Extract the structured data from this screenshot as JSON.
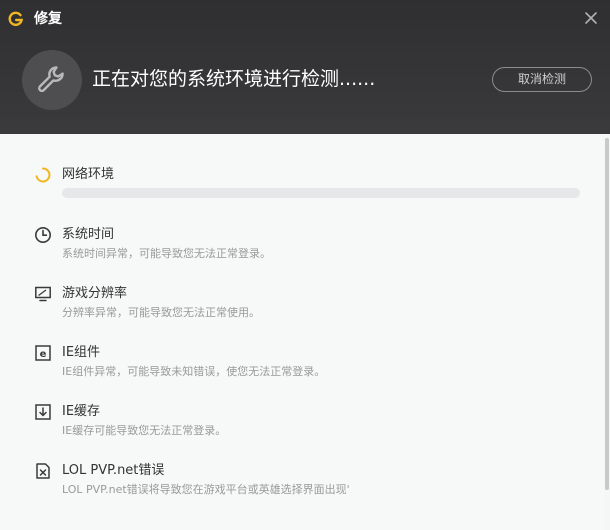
{
  "window": {
    "title": "修复",
    "close_icon": "close-icon",
    "logo_icon": "g-logo-icon"
  },
  "header": {
    "headline": "正在对您的系统环境进行检测......",
    "cancel_label": "取消检测",
    "icon": "wrench-icon"
  },
  "items": [
    {
      "icon": "loading-spinner-icon",
      "title": "网络环境",
      "progress": 0,
      "status": "checking"
    },
    {
      "icon": "clock-icon",
      "title": "系统时间",
      "description": "系统时间异常，可能导致您无法正常登录。"
    },
    {
      "icon": "monitor-icon",
      "title": "游戏分辨率",
      "description": "分辨率异常，可能导致您无法正常使用。"
    },
    {
      "icon": "ie-icon",
      "title": "IE组件",
      "description": "IE组件异常，可能导致未知错误，使您无法正常登录。"
    },
    {
      "icon": "download-box-icon",
      "title": "IE缓存",
      "description": "IE缓存可能导致您无法正常登录。"
    },
    {
      "icon": "file-x-icon",
      "title": "LOL PVP.net错误",
      "description": "LOL PVP.net错误将导致您在游戏平台或英雄选择界面出现'"
    }
  ],
  "colors": {
    "header_bg": "#333335",
    "accent": "#f1b722",
    "content_bg": "#f7f8f8"
  }
}
